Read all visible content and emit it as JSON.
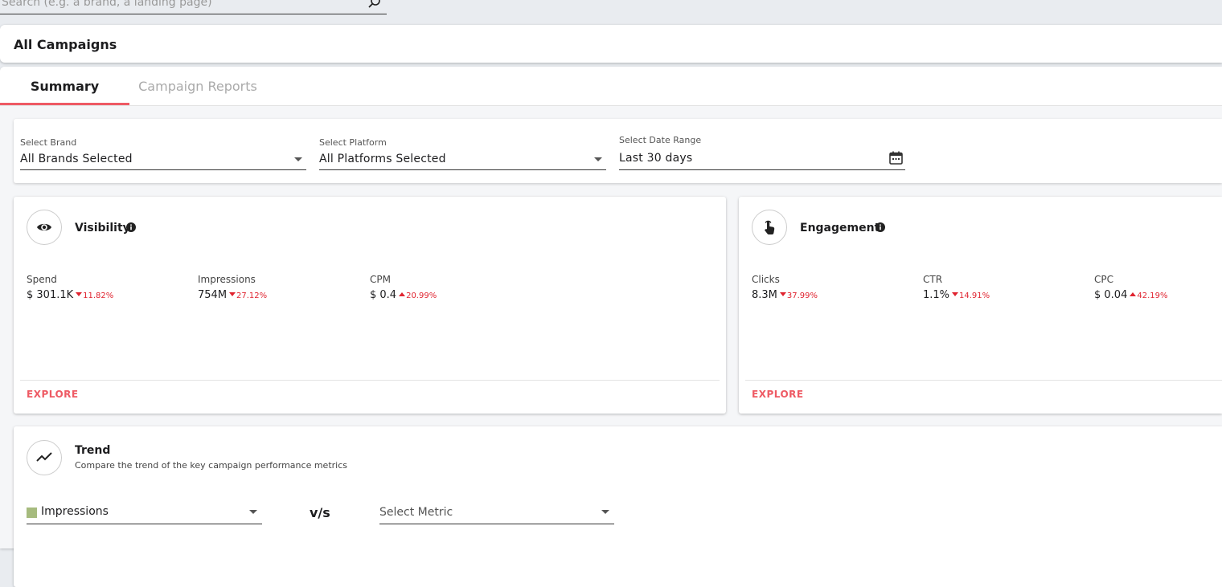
{
  "search": {
    "placeholder": "Search (e.g. a brand, a landing page)"
  },
  "header": {
    "title": "All Campaigns"
  },
  "tabs": [
    {
      "label": "Summary",
      "active": true
    },
    {
      "label": "Campaign Reports",
      "active": false
    }
  ],
  "filters": {
    "brand": {
      "label": "Select Brand",
      "value": "All Brands Selected"
    },
    "platform": {
      "label": "Select Platform",
      "value": "All Platforms Selected"
    },
    "date_range": {
      "label": "Select Date Range",
      "value": "Last 30 days"
    }
  },
  "visibility": {
    "title": "Visibility",
    "icon": "eye-icon",
    "metrics": [
      {
        "label": "Spend",
        "value": "$ 301.1K",
        "direction": "down",
        "delta": "11.82%"
      },
      {
        "label": "Impressions",
        "value": "754M",
        "direction": "down",
        "delta": "27.12%"
      },
      {
        "label": "CPM",
        "value": "$ 0.4",
        "direction": "up",
        "delta": "20.99%"
      }
    ],
    "explore_label": "EXPLORE"
  },
  "engagement": {
    "title": "Engagement",
    "icon": "pointer-hand-icon",
    "metrics": [
      {
        "label": "Clicks",
        "value": "8.3M",
        "direction": "down",
        "delta": "37.99%"
      },
      {
        "label": "CTR",
        "value": "1.1%",
        "direction": "down",
        "delta": "14.91%"
      },
      {
        "label": "CPC",
        "value": "$ 0.04",
        "direction": "up",
        "delta": "42.19%"
      }
    ],
    "explore_label": "EXPLORE"
  },
  "trend": {
    "title": "Trend",
    "subtitle": "Compare the trend of the key campaign performance metrics",
    "metric_a": {
      "value": "Impressions",
      "color": "#a6bb7e"
    },
    "vs_label": "v/s",
    "metric_b": {
      "placeholder": "Select Metric"
    }
  },
  "colors": {
    "accent": "#ee5a64",
    "negative": "#e0232f"
  }
}
